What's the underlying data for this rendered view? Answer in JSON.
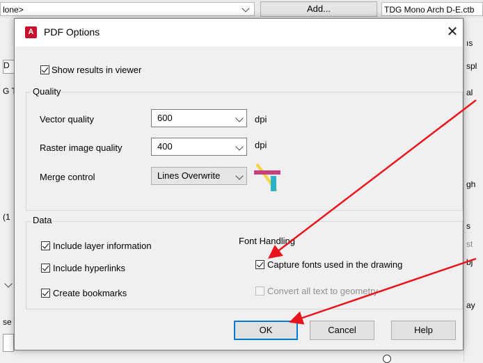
{
  "background": {
    "top_left_field": "lone>",
    "add_button": "Add...",
    "ctb_field": "TDG Mono Arch D-E.ctb",
    "left_fragments": [
      "D",
      "G T",
      "(1",
      "se"
    ],
    "right_fragments": [
      "ıs",
      "spl",
      "al",
      "gh",
      "s",
      "st",
      "bj",
      "ay"
    ]
  },
  "dialog": {
    "title": "PDF Options",
    "app_icon": "autocad-a-icon",
    "close_icon": "close-icon",
    "show_results": {
      "label": "Show results in viewer",
      "checked": true
    },
    "quality": {
      "title": "Quality",
      "vector_label": "Vector quality",
      "vector_value": "600",
      "vector_unit": "dpi",
      "raster_label": "Raster image quality",
      "raster_value": "400",
      "raster_unit": "dpi",
      "merge_label": "Merge control",
      "merge_value": "Lines Overwrite",
      "merge_icon": "lines-overwrite-icon"
    },
    "data": {
      "title": "Data",
      "layer_info": {
        "label": "Include layer information",
        "checked": true
      },
      "hyperlinks": {
        "label": "Include hyperlinks",
        "checked": true
      },
      "bookmarks": {
        "label": "Create bookmarks",
        "checked": true
      },
      "font_handling_title": "Font Handling",
      "capture_fonts": {
        "label": "Capture fonts used in the drawing",
        "checked": true
      },
      "convert_text": {
        "label": "Convert all text to geometry",
        "checked": false,
        "disabled": true
      }
    },
    "buttons": {
      "ok": "OK",
      "cancel": "Cancel",
      "help": "Help"
    }
  },
  "annotation_color": "#e8141b"
}
